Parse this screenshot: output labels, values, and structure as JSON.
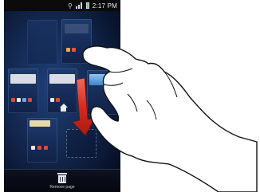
{
  "status_bar": {
    "time": "2:17 PM",
    "icons": [
      "usb-icon",
      "signal-icon",
      "battery-icon"
    ]
  },
  "home_screen_editor": {
    "remove_label": "Remove page",
    "remove_icon": "trash-icon"
  },
  "overlay": {
    "drag_arrow_icon": "arrow-down-icon",
    "hand_icon": "pointing-hand-icon",
    "arrow_color": "#d72a1e"
  }
}
